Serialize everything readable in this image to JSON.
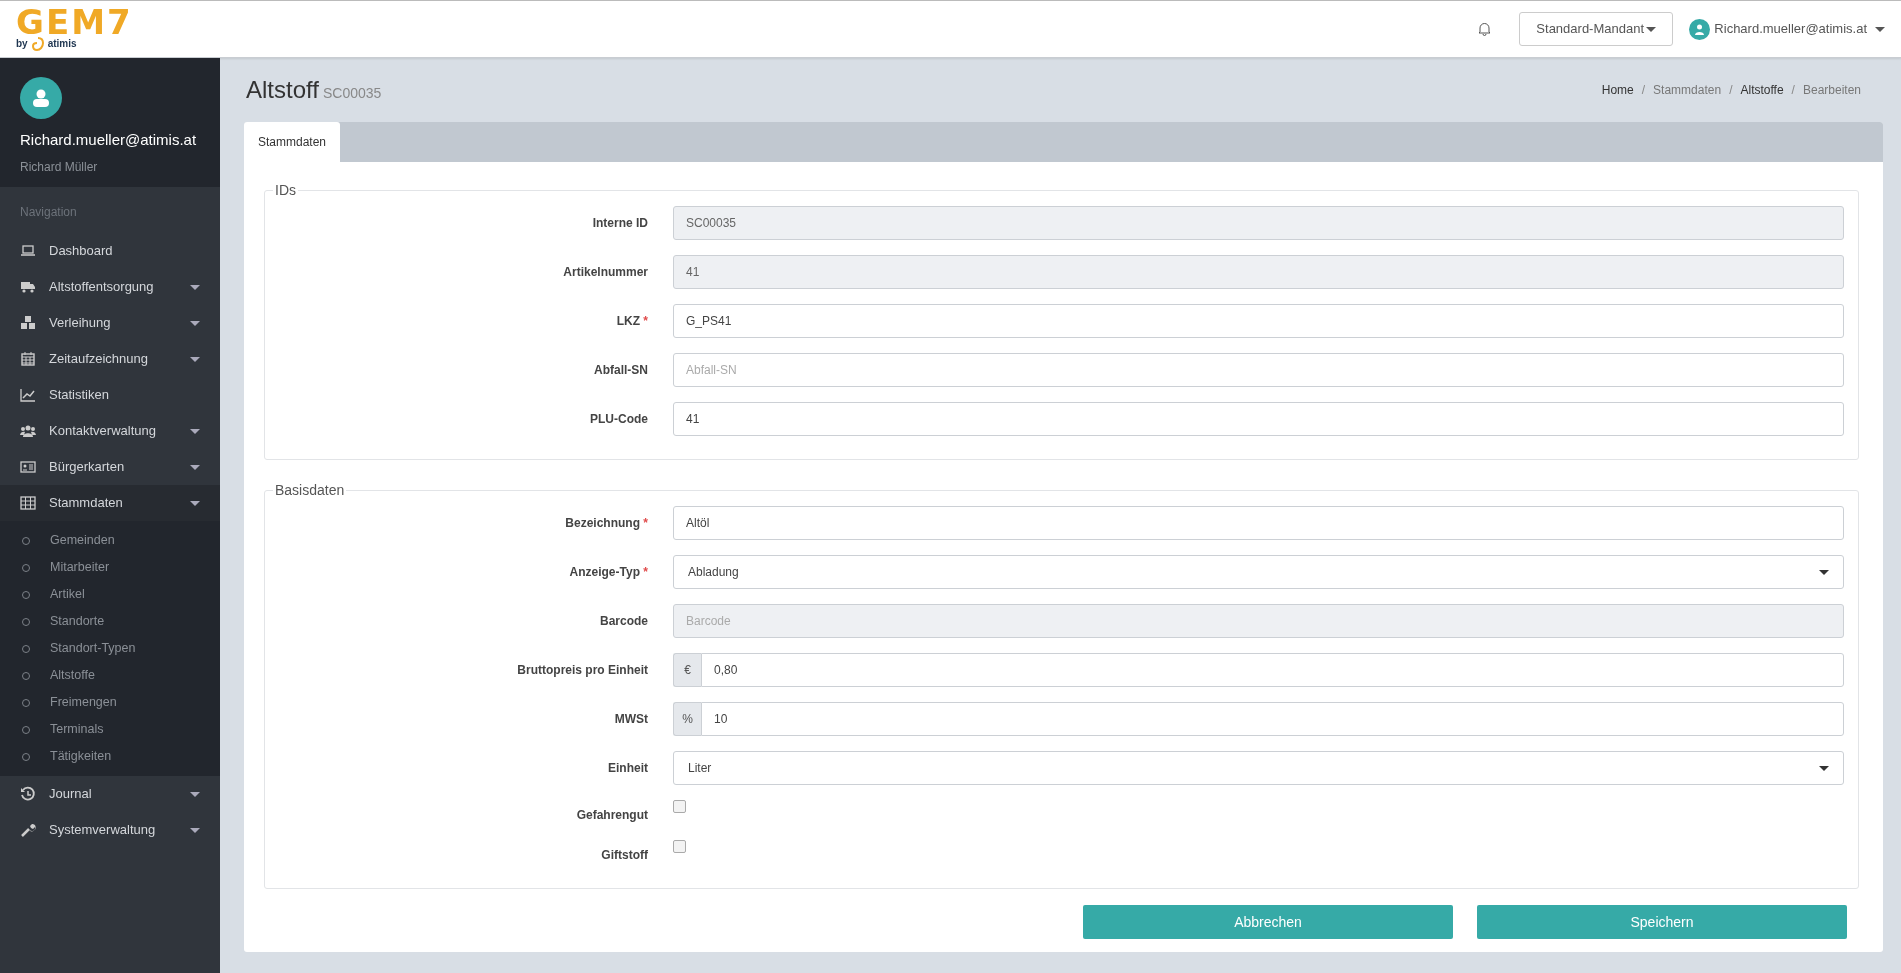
{
  "header": {
    "logo": "GEM7",
    "logo_sub_by": "by",
    "logo_sub_brand": "atimis",
    "tenant": "Standard-Mandant",
    "user": "Richard.mueller@atimis.at"
  },
  "sidebar": {
    "user_email": "Richard.mueller@atimis.at",
    "user_name": "Richard Müller",
    "section_label": "Navigation",
    "items": [
      {
        "label": "Dashboard",
        "expandable": false
      },
      {
        "label": "Altstoffentsorgung",
        "expandable": true,
        "expanded": false
      },
      {
        "label": "Verleihung",
        "expandable": true,
        "expanded": false
      },
      {
        "label": "Zeitaufzeichnung",
        "expandable": true,
        "expanded": false
      },
      {
        "label": "Statistiken",
        "expandable": false
      },
      {
        "label": "Kontaktverwaltung",
        "expandable": true,
        "expanded": false
      },
      {
        "label": "Bürgerkarten",
        "expandable": true,
        "expanded": false
      },
      {
        "label": "Stammdaten",
        "expandable": true,
        "expanded": true,
        "children": [
          {
            "label": "Gemeinden"
          },
          {
            "label": "Mitarbeiter"
          },
          {
            "label": "Artikel"
          },
          {
            "label": "Standorte"
          },
          {
            "label": "Standort-Typen"
          },
          {
            "label": "Altstoffe"
          },
          {
            "label": "Freimengen"
          },
          {
            "label": "Terminals"
          },
          {
            "label": "Tätigkeiten"
          }
        ]
      },
      {
        "label": "Journal",
        "expandable": true,
        "expanded": false
      },
      {
        "label": "Systemverwaltung",
        "expandable": true,
        "expanded": false
      }
    ]
  },
  "page": {
    "title": "Altstoff",
    "subtitle": "SC00035",
    "breadcrumb_separator": "/",
    "breadcrumb": [
      {
        "label": "Home",
        "link": true
      },
      {
        "label": "Stammdaten",
        "link": false
      },
      {
        "label": "Altstoffe",
        "link": true
      },
      {
        "label": "Bearbeiten",
        "link": false
      }
    ]
  },
  "tabs": [
    {
      "label": "Stammdaten",
      "selected": true
    }
  ],
  "fieldsets": [
    {
      "legend": "IDs",
      "fields": [
        {
          "kind": "text",
          "label": "Interne ID",
          "disabled": true,
          "value": "SC00035"
        },
        {
          "kind": "text",
          "label": "Artikelnummer",
          "disabled": true,
          "value": "41"
        },
        {
          "kind": "text",
          "label": "LKZ",
          "required_mark": "*",
          "disabled": false,
          "value": "G_PS41"
        },
        {
          "kind": "text",
          "label": "Abfall-SN",
          "disabled": false,
          "placeholder": "Abfall-SN"
        },
        {
          "kind": "text",
          "label": "PLU-Code",
          "disabled": false,
          "value": "41"
        }
      ]
    },
    {
      "legend": "Basisdaten",
      "fields": [
        {
          "kind": "text",
          "label": "Bezeichnung",
          "required_mark": "*",
          "disabled": false,
          "value": "Altöl"
        },
        {
          "kind": "select",
          "label": "Anzeige-Typ",
          "required_mark": "*",
          "value": "Abladung"
        },
        {
          "kind": "text",
          "label": "Barcode",
          "disabled": true,
          "placeholder": "Barcode"
        },
        {
          "kind": "addon",
          "label": "Bruttopreis pro Einheit",
          "addon": "€",
          "value": "0,80"
        },
        {
          "kind": "addon",
          "label": "MWSt",
          "addon": "%",
          "value": "10"
        },
        {
          "kind": "select",
          "label": "Einheit",
          "value": "Liter"
        },
        {
          "kind": "checkbox",
          "label": "Gefahrengut",
          "checked": false
        },
        {
          "kind": "checkbox",
          "label": "Giftstoff",
          "checked": false
        }
      ]
    }
  ],
  "buttons": [
    "Abbrechen",
    "Speichern"
  ]
}
